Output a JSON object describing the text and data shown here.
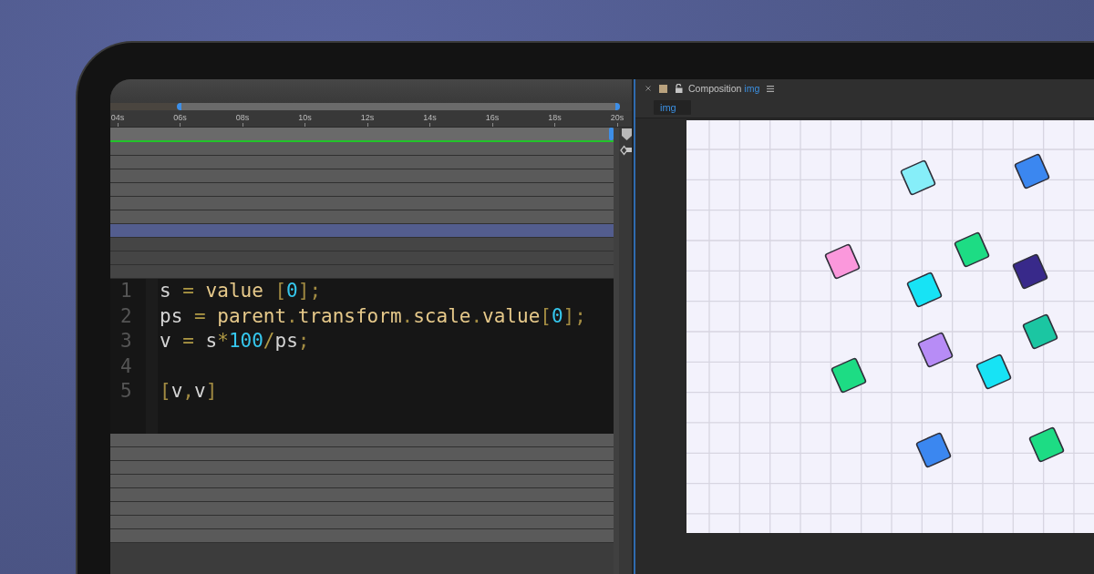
{
  "timeline": {
    "time_navigator": {
      "level": 0.87
    },
    "ruler_labels": [
      "04s",
      "06s",
      "08s",
      "10s",
      "12s",
      "14s",
      "16s",
      "18s",
      "20s"
    ],
    "track_rows": [
      {
        "kind": "bar",
        "selected": false
      },
      {
        "kind": "bar",
        "selected": false
      },
      {
        "kind": "bar",
        "selected": false
      },
      {
        "kind": "bar",
        "selected": false
      },
      {
        "kind": "bar",
        "selected": false
      },
      {
        "kind": "bar",
        "selected": false
      },
      {
        "kind": "bar",
        "selected": true
      },
      {
        "kind": "empty",
        "selected": false
      },
      {
        "kind": "empty",
        "selected": false
      },
      {
        "kind": "empty",
        "selected": false
      }
    ],
    "code_editor": {
      "lines": [
        {
          "number": "1",
          "tokens": [
            {
              "text": "s",
              "kind": "variable"
            },
            {
              "text": " = ",
              "kind": "operator"
            },
            {
              "text": "value",
              "kind": "property"
            },
            {
              "text": " [",
              "kind": "punctuation"
            },
            {
              "text": "0",
              "kind": "number"
            },
            {
              "text": "];",
              "kind": "punctuation"
            }
          ]
        },
        {
          "number": "2",
          "tokens": [
            {
              "text": "ps",
              "kind": "variable"
            },
            {
              "text": " = ",
              "kind": "operator"
            },
            {
              "text": "parent",
              "kind": "property"
            },
            {
              "text": ".",
              "kind": "punctuation"
            },
            {
              "text": "transform",
              "kind": "property"
            },
            {
              "text": ".",
              "kind": "punctuation"
            },
            {
              "text": "scale",
              "kind": "property"
            },
            {
              "text": ".",
              "kind": "punctuation"
            },
            {
              "text": "value",
              "kind": "property"
            },
            {
              "text": "[",
              "kind": "punctuation"
            },
            {
              "text": "0",
              "kind": "number"
            },
            {
              "text": "];",
              "kind": "punctuation"
            }
          ]
        },
        {
          "number": "3",
          "tokens": [
            {
              "text": "v",
              "kind": "variable"
            },
            {
              "text": " = ",
              "kind": "operator"
            },
            {
              "text": "s",
              "kind": "variable"
            },
            {
              "text": "*",
              "kind": "operator"
            },
            {
              "text": "100",
              "kind": "number"
            },
            {
              "text": "/",
              "kind": "operator"
            },
            {
              "text": "ps",
              "kind": "variable"
            },
            {
              "text": ";",
              "kind": "punctuation"
            }
          ]
        },
        {
          "number": "4"
        },
        {
          "number": "5",
          "tokens": [
            {
              "text": "[",
              "kind": "punctuation"
            },
            {
              "text": "v",
              "kind": "variable"
            },
            {
              "text": ",",
              "kind": "punctuation"
            },
            {
              "text": "v",
              "kind": "variable"
            },
            {
              "text": "]",
              "kind": "punctuation"
            }
          ]
        }
      ]
    },
    "lower_rows": [
      {
        "kind": "bar",
        "selected": false
      },
      {
        "kind": "bar",
        "selected": false
      },
      {
        "kind": "bar",
        "selected": false
      },
      {
        "kind": "bar",
        "selected": false
      },
      {
        "kind": "bar",
        "selected": false
      },
      {
        "kind": "bar",
        "selected": false
      },
      {
        "kind": "bar",
        "selected": false
      },
      {
        "kind": "bar",
        "selected": false
      }
    ]
  },
  "composition_panel": {
    "title": "Composition",
    "comp_name": "img",
    "viewer_tabs": [
      {
        "label": "img",
        "selected": true
      }
    ],
    "tiles": [
      {
        "color": "#86eef9"
      },
      {
        "color": "#3b87f0"
      },
      {
        "color": "#1ddc84"
      },
      {
        "color": "#fb98dc"
      },
      {
        "color": "#38298a"
      },
      {
        "color": "#17e3f5"
      },
      {
        "color": "#1bc6a2"
      },
      {
        "color": "#b78cf6"
      },
      {
        "color": "#1ddc84"
      },
      {
        "color": "#17e3f5"
      },
      {
        "color": "#3b87f0"
      },
      {
        "color": "#1ddc84"
      }
    ]
  }
}
